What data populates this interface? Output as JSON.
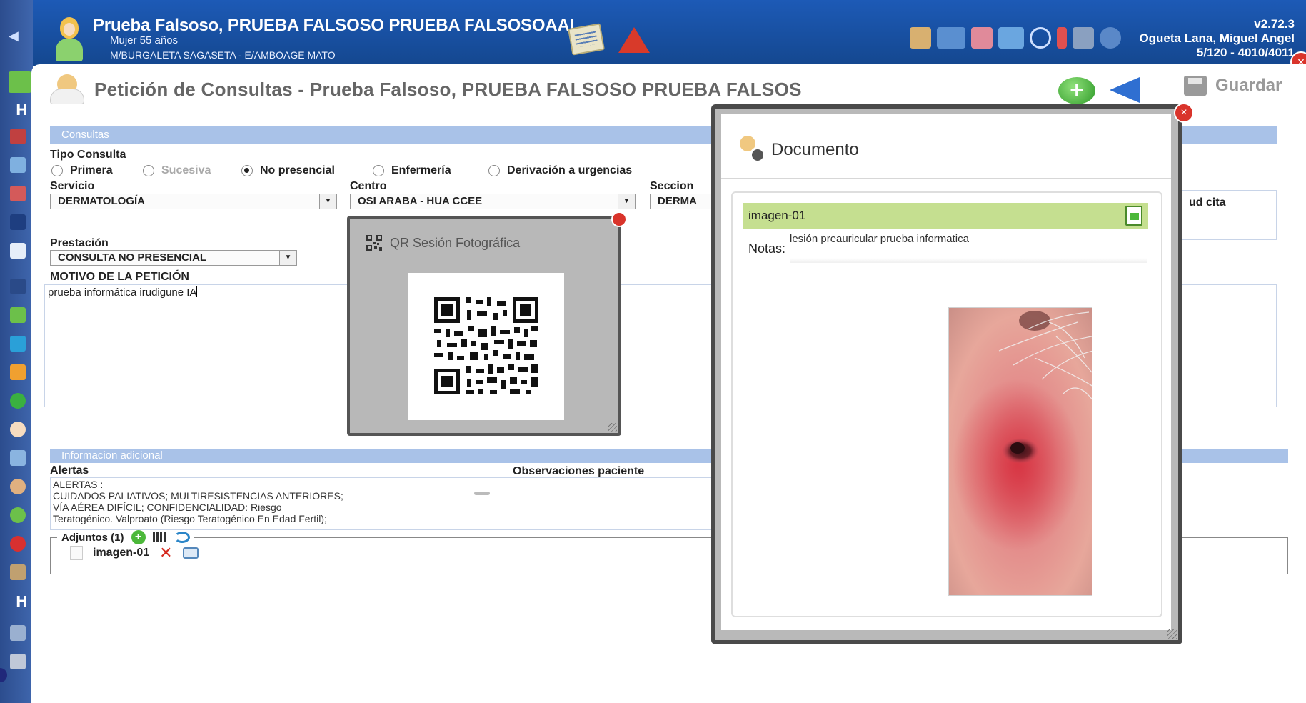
{
  "header": {
    "patient_name": "Prueba Falsoso, PRUEBA FALSOSO PRUEBA FALSOSOAAL",
    "patient_sex_age": "Mujer  55 años",
    "patient_location": "M/BURGALETA SAGASETA - E/AMBOAGE MATO",
    "version": "v2.72.3",
    "doctor": "Ogueta Lana, Miguel Angel",
    "codes": "5/120 - 4010/4011",
    "colors": {
      "header_bg": "#1d5ab6",
      "alert": "#d83a2a"
    }
  },
  "page": {
    "title": "Petición de Consultas - Prueba Falsoso, PRUEBA FALSOSO PRUEBA FALSOS",
    "save_label": "Guardar"
  },
  "consultas": {
    "section_label": "Consultas",
    "tipo_label": "Tipo Consulta",
    "tipos": [
      {
        "label": "Primera",
        "selected": false,
        "disabled": false
      },
      {
        "label": "Sucesiva",
        "selected": false,
        "disabled": true
      },
      {
        "label": "No presencial",
        "selected": true,
        "disabled": false
      },
      {
        "label": "Enfermería",
        "selected": false,
        "disabled": false
      },
      {
        "label": "Derivación a urgencias",
        "selected": false,
        "disabled": false
      }
    ],
    "servicio_label": "Servicio",
    "servicio_value": "DERMATOLOGÍA",
    "centro_label": "Centro",
    "centro_value": "OSI ARABA - HUA CCEE",
    "seccion_label": "Seccion",
    "seccion_value": "DERMA",
    "fecha_label_partial": "ud cita",
    "prestacion_label": "Prestación",
    "prestacion_value": "CONSULTA NO PRESENCIAL",
    "motivo_label": "MOTIVO DE LA PETICIÓN",
    "motivo_value": "prueba informática irudigune IA"
  },
  "info_adicional": {
    "section_label": "Informacion adicional",
    "alertas_label": "Alertas",
    "alertas_lines": [
      "ALERTAS :",
      "CUIDADOS PALIATIVOS; MULTIRESISTENCIAS ANTERIORES;",
      "VÍA AÉREA DIFÍCIL; CONFIDENCIALIDAD: Riesgo",
      "Teratogénico. Valproato (Riesgo Teratogénico En Edad Fertil);"
    ],
    "observaciones_label": "Observaciones paciente",
    "adjuntos_label": "Adjuntos (1)",
    "adjuntos": [
      {
        "name": "imagen-01"
      }
    ]
  },
  "qr_popup": {
    "title": "QR Sesión Fotográfica",
    "icon": "qr-code-icon"
  },
  "doc_popup": {
    "title": "Documento",
    "image_name": "imagen-01",
    "notas_label": "Notas:",
    "notas_value": "lesión preauricular prueba informatica",
    "bar_color": "#c5df90"
  }
}
